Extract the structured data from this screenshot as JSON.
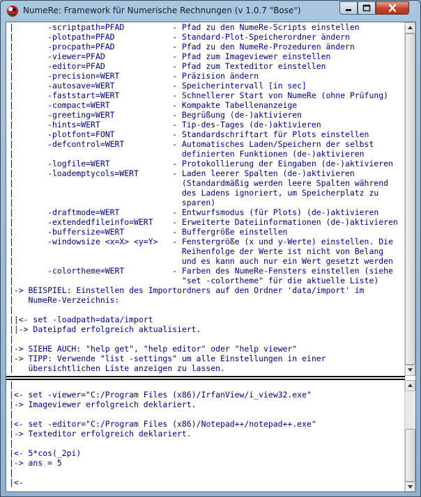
{
  "window": {
    "title": "NumeRe: Framework für Numerische Rechnungen (v 1.0.7 \"Bose\")"
  },
  "colors": {
    "text": "#000080",
    "console_bg": "#ffffff",
    "close_button": "#c0432b"
  },
  "help_output": [
    "|       -scriptpath=PFAD          - Pfad zu den NumeRe-Scripts einstellen",
    "|       -plotpath=PFAD            - Standard-Plot-Speicherordner ändern",
    "|       -procpath=PFAD            - Pfad zu den NumeRe-Prozeduren ändern",
    "|       -viewer=PFAD              - Pfad zum Imageviewer einstellen",
    "|       -editor=PFAD              - Pfad zum Texteditor einstellen",
    "|       -precision=WERT           - Präzision ändern",
    "|       -autosave=WERT            - Speicherintervall [in sec]",
    "|       -faststart=WERT           - Schnellerer Start von NumeRe (ohne Prüfung)",
    "|       -compact=WERT             - Kompakte Tabellenanzeige",
    "|       -greeting=WERT            - Begrüßung (de-)aktivieren",
    "|       -hints=WERT               - Tip-des-Tages (de-)aktivieren",
    "|       -plotfont=FONT            - Standardschriftart für Plots einstellen",
    "|       -defcontrol=WERT          - Automatisches Laden/Speichern der selbst",
    "|                                   definierten Funktionen (de-)aktivieren",
    "|       -logfile=WERT             - Protokollierung der Eingaben (de-)aktivieren",
    "|       -loademptycols=WERT       - Laden leerer Spalten (de-)aktivieren",
    "|                                   (Standardmäßig werden leere Spalten während",
    "|                                   des Ladens ignoriert, um Speicherplatz zu",
    "|                                   sparen)",
    "|       -draftmode=WERT           - Entwurfsmodus (für Plots) (de-)aktivieren",
    "|       -extendedfileinfo=WERT    - Erweiterte Dateiinformationen (de-)aktivieren",
    "|       -buffersize=WERT          - Buffergröße einstellen",
    "|       -windowsize <x=X> <y=Y>   - Fenstergröße (x und y-Werte) einstellen. Die",
    "|                                   Reihenfolge der Werte ist nicht von Belang",
    "|                                   und es kann auch nur ein Wert gesetzt werden",
    "|       -colortheme=WERT          - Farben des NumeRe-Fensters einstellen (siehe",
    "|                                   \"set -colortheme\" für die aktuelle Liste)",
    "|-> BEISPIEL: Einstellen des Importordners auf den Ordner 'data/import' im",
    "|   NumeRe-Verzeichnis:",
    "|",
    "||<- set -loadpath=data/import",
    "||-> Dateipfad erfolgreich aktualisiert.",
    "|",
    "|-> SIEHE AUCH: \"help get\", \"help editor\" oder \"help viewer\"",
    "|-> TIPP: Verwende \"list -settings\" um alle Einstellungen in einer",
    "|   übersichtlichen Liste anzeigen zu lassen."
  ],
  "console_output": [
    "|",
    "|<- set -viewer=\"C:/Program Files (x86)/IrfanView/i_view32.exe\"",
    "|-> Imageviewer erfolgreich deklariert.",
    "|",
    "|<- set -editor=\"C:/Program Files (x86)/Notepad++/notepad++.exe\"",
    "|-> Texteditor erfolgreich deklariert.",
    "|",
    "|<- 5*cos(_2pi)",
    "|-> ans = 5",
    "|",
    "|<-"
  ]
}
